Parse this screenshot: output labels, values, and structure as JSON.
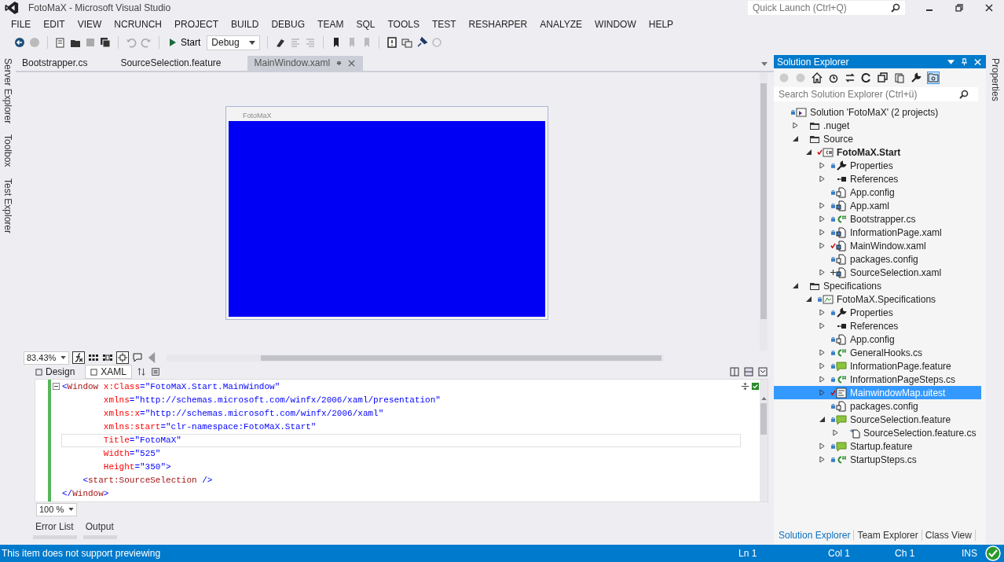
{
  "window": {
    "title": "FotoMaX - Microsoft Visual Studio",
    "quick_launch": {
      "placeholder": "Quick Launch (Ctrl+Q)"
    }
  },
  "menu": [
    "FILE",
    "EDIT",
    "VIEW",
    "NCRUNCH",
    "PROJECT",
    "BUILD",
    "DEBUG",
    "TEAM",
    "SQL",
    "TOOLS",
    "TEST",
    "RESHARPER",
    "ANALYZE",
    "WINDOW",
    "HELP"
  ],
  "toolbar": {
    "start_label": "Start",
    "configuration": "Debug"
  },
  "left_tabs": [
    "Server Explorer",
    "Toolbox",
    "Test Explorer"
  ],
  "right_tabs": [
    "Properties"
  ],
  "document_tabs": [
    {
      "label": "Bootstrapper.cs",
      "selected": false
    },
    {
      "label": "SourceSelection.feature",
      "selected": false
    },
    {
      "label": "MainWindow.xaml",
      "selected": true
    }
  ],
  "designer": {
    "window_title": "FotoMaX",
    "zoom": "83.43%"
  },
  "view_tabs": [
    {
      "label": "Design",
      "selected": false
    },
    {
      "label": "XAML",
      "selected": true
    }
  ],
  "code": [
    {
      "current": false,
      "segments": [
        {
          "t": "<",
          "kind": "punct"
        },
        {
          "t": "Window",
          "kind": "tag"
        },
        {
          "t": " x:Class",
          "kind": "attr"
        },
        {
          "t": "=\"FotoMaX.Start.MainWindow\"",
          "kind": "value"
        }
      ]
    },
    {
      "current": false,
      "segments": [
        {
          "t": "        xmlns",
          "kind": "attr"
        },
        {
          "t": "=\"http://schemas.microsoft.com/winfx/2006/xaml/presentation\"",
          "kind": "value"
        }
      ]
    },
    {
      "current": false,
      "segments": [
        {
          "t": "        xmlns:x",
          "kind": "attr"
        },
        {
          "t": "=\"http://schemas.microsoft.com/winfx/2006/xaml\"",
          "kind": "value"
        }
      ]
    },
    {
      "current": false,
      "segments": [
        {
          "t": "        xmlns:start",
          "kind": "attr"
        },
        {
          "t": "=\"clr-namespace:FotoMaX.Start\"",
          "kind": "value"
        }
      ]
    },
    {
      "current": true,
      "segments": [
        {
          "t": "        Title",
          "kind": "attr"
        },
        {
          "t": "=\"FotoMaX\"",
          "kind": "value"
        }
      ]
    },
    {
      "current": false,
      "segments": [
        {
          "t": "        Width",
          "kind": "attr"
        },
        {
          "t": "=\"525\"",
          "kind": "value"
        }
      ]
    },
    {
      "current": false,
      "segments": [
        {
          "t": "        Height",
          "kind": "attr"
        },
        {
          "t": "=\"350\">",
          "kind": "value"
        }
      ]
    },
    {
      "current": false,
      "segments": [
        {
          "t": "    <",
          "kind": "punct"
        },
        {
          "t": "start:SourceSelection",
          "kind": "tag"
        },
        {
          "t": " />",
          "kind": "punct"
        }
      ]
    },
    {
      "current": false,
      "segments": [
        {
          "t": "</",
          "kind": "punct"
        },
        {
          "t": "Window",
          "kind": "tag"
        },
        {
          "t": ">",
          "kind": "punct"
        }
      ]
    }
  ],
  "code_zoom": "100 %",
  "tool_tabs": [
    {
      "label": "Error List",
      "selected": false
    },
    {
      "label": "Output",
      "selected": false
    }
  ],
  "solution_explorer": {
    "title": "Solution Explorer",
    "search": {
      "placeholder": "Search Solution Explorer (Ctrl+ü)"
    },
    "tree": [
      {
        "label": "Solution 'FotoMaX' (2 projects)",
        "kind": "solution",
        "source_control": {
          "kind": "locked"
        },
        "selected": false,
        "children": [
          {
            "label": ".nuget",
            "kind": "folder",
            "selected": false,
            "expanded": false
          },
          {
            "label": "Source",
            "kind": "folder",
            "selected": false,
            "expanded": true,
            "children": [
              {
                "label": "FotoMaX.Start",
                "kind": "project",
                "startup": true,
                "source_control": {
                  "kind": "checked_out"
                },
                "selected": false,
                "expanded": true,
                "children": [
                  {
                    "label": "Properties",
                    "kind": "properties",
                    "source_control": {
                      "kind": "locked"
                    },
                    "selected": false,
                    "expanded": false
                  },
                  {
                    "label": "References",
                    "kind": "references",
                    "selected": false,
                    "expanded": false
                  },
                  {
                    "label": "App.config",
                    "kind": "config",
                    "source_control": {
                      "kind": "locked"
                    },
                    "selected": false
                  },
                  {
                    "label": "App.xaml",
                    "kind": "xaml",
                    "source_control": {
                      "kind": "locked"
                    },
                    "selected": false,
                    "expanded": false
                  },
                  {
                    "label": "Bootstrapper.cs",
                    "kind": "cs",
                    "source_control": {
                      "kind": "locked"
                    },
                    "selected": false,
                    "expanded": false
                  },
                  {
                    "label": "InformationPage.xaml",
                    "kind": "xaml",
                    "source_control": {
                      "kind": "locked"
                    },
                    "selected": false,
                    "expanded": false
                  },
                  {
                    "label": "MainWindow.xaml",
                    "kind": "xaml",
                    "source_control": {
                      "kind": "checked_out"
                    },
                    "selected": false,
                    "expanded": false
                  },
                  {
                    "label": "packages.config",
                    "kind": "config",
                    "source_control": {
                      "kind": "locked"
                    },
                    "selected": false
                  },
                  {
                    "label": "SourceSelection.xaml",
                    "kind": "xaml",
                    "source_control": {
                      "kind": "added"
                    },
                    "selected": false,
                    "expanded": false
                  }
                ]
              }
            ]
          },
          {
            "label": "Specifications",
            "kind": "folder",
            "selected": false,
            "expanded": true,
            "children": [
              {
                "label": "FotoMaX.Specifications",
                "kind": "test_project",
                "source_control": {
                  "kind": "locked"
                },
                "selected": false,
                "expanded": true,
                "children": [
                  {
                    "label": "Properties",
                    "kind": "properties",
                    "source_control": {
                      "kind": "locked"
                    },
                    "selected": false,
                    "expanded": false
                  },
                  {
                    "label": "References",
                    "kind": "references",
                    "selected": false,
                    "expanded": false
                  },
                  {
                    "label": "App.config",
                    "kind": "config",
                    "source_control": {
                      "kind": "locked"
                    },
                    "selected": false
                  },
                  {
                    "label": "GeneralHooks.cs",
                    "kind": "cs",
                    "source_control": {
                      "kind": "locked"
                    },
                    "selected": false,
                    "expanded": false
                  },
                  {
                    "label": "InformationPage.feature",
                    "kind": "feature",
                    "source_control": {
                      "kind": "locked"
                    },
                    "selected": false,
                    "expanded": false
                  },
                  {
                    "label": "InformationPageSteps.cs",
                    "kind": "cs",
                    "source_control": {
                      "kind": "locked"
                    },
                    "selected": false,
                    "expanded": false
                  },
                  {
                    "label": "MainwindowMap.uitest",
                    "kind": "uitest",
                    "source_control": {
                      "kind": "checked_out"
                    },
                    "selected": true,
                    "expanded": false
                  },
                  {
                    "label": "packages.config",
                    "kind": "config",
                    "source_control": {
                      "kind": "locked"
                    },
                    "selected": false
                  },
                  {
                    "label": "SourceSelection.feature",
                    "kind": "feature",
                    "source_control": {
                      "kind": "locked"
                    },
                    "selected": false,
                    "expanded": true,
                    "children": [
                      {
                        "label": "SourceSelection.feature.cs",
                        "kind": "generated",
                        "selected": false,
                        "expanded": false
                      }
                    ]
                  },
                  {
                    "label": "Startup.feature",
                    "kind": "feature",
                    "source_control": {
                      "kind": "locked"
                    },
                    "selected": false,
                    "expanded": false
                  },
                  {
                    "label": "StartupSteps.cs",
                    "kind": "cs",
                    "source_control": {
                      "kind": "locked"
                    },
                    "selected": false,
                    "expanded": false
                  }
                ]
              }
            ]
          }
        ]
      }
    ],
    "bottom_tabs": [
      {
        "label": "Solution Explorer",
        "selected": true
      },
      {
        "label": "Team Explorer",
        "selected": false
      },
      {
        "label": "Class View",
        "selected": false
      }
    ]
  },
  "status_bar": {
    "message": "This item does not support previewing",
    "line": "Ln 1",
    "column": "Col 1",
    "char": "Ch 1",
    "mode": "INS"
  }
}
